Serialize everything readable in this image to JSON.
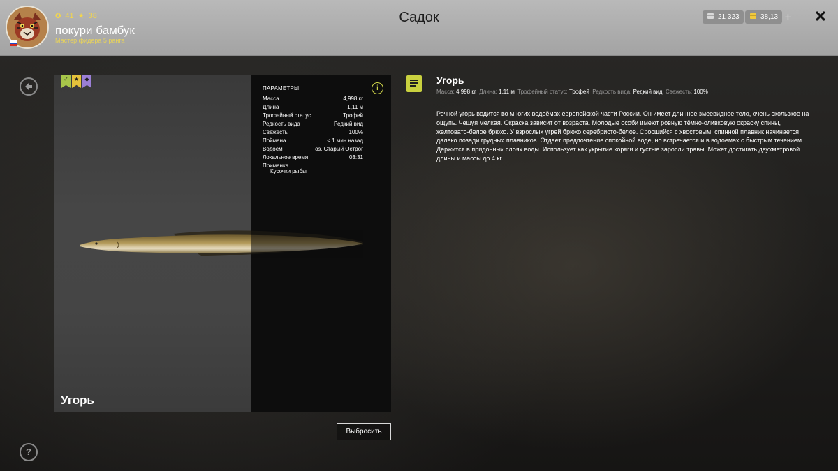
{
  "header": {
    "title": "Садок",
    "player": {
      "name": "покури бамбук",
      "rank": "Мастер фидера 5 ранга",
      "level": "41",
      "stars": "38"
    },
    "currency": {
      "silver": "21 323",
      "gold": "38,13"
    }
  },
  "card": {
    "fish_name": "Угорь",
    "badges": [
      "✓",
      "★",
      "◆"
    ],
    "params_title": "ПАРАМЕТРЫ",
    "params": [
      {
        "label": "Масса",
        "value": "4,998 кг"
      },
      {
        "label": "Длина",
        "value": "1,11 м"
      },
      {
        "label": "Трофейный статус",
        "value": "Трофей"
      },
      {
        "label": "Редкость вида",
        "value": "Редкий вид"
      },
      {
        "label": "Свежесть",
        "value": "100%"
      },
      {
        "label": "Поймана",
        "value": "< 1 мин назад"
      },
      {
        "label": "Водоём",
        "value": "оз. Старый Острог"
      },
      {
        "label": "Локальное время",
        "value": "03:31"
      },
      {
        "label": "Приманка",
        "value": ""
      }
    ],
    "bait_item": "Кусочки рыбы",
    "throw_button": "Выбросить"
  },
  "description": {
    "title": "Угорь",
    "meta": [
      {
        "label": "Масса:",
        "value": "4,998 кг"
      },
      {
        "label": "Длина:",
        "value": "1,11 м"
      },
      {
        "label": "Трофейный статус:",
        "value": "Трофей"
      },
      {
        "label": "Редкость вида:",
        "value": "Редкий вид"
      },
      {
        "label": "Свежесть:",
        "value": "100%"
      }
    ],
    "text": "Речной угорь водится во многих водоёмах европейской части России. Он имеет длинное змеевидное тело, очень скользкое на ощупь. Чешуя мелкая. Окраска зависит от возраста. Молодые особи имеют ровную тёмно-оливковую окраску спины, желтовато-белое брюхо. У взрослых угрей брюхо серебристо-белое. Сросшийся с хвостовым, спинной плавник начинается далеко позади грудных плавников. Отдает предпочтение спокойной воде, но встречается и в водоемах с быстрым течением. Держится в придонных слоях воды. Использует как укрытие коряги и густые заросли травы. Может достигать двухметровой длины и массы до 4 кг."
  },
  "colors": {
    "accent": "#c9d13f",
    "topbar": "#a8a8a8",
    "panel_dark": "#0d0d0d"
  },
  "icons": {
    "back": "back-icon",
    "help": "help-icon",
    "info": "info-icon",
    "document": "document-icon",
    "close": "close-icon"
  }
}
